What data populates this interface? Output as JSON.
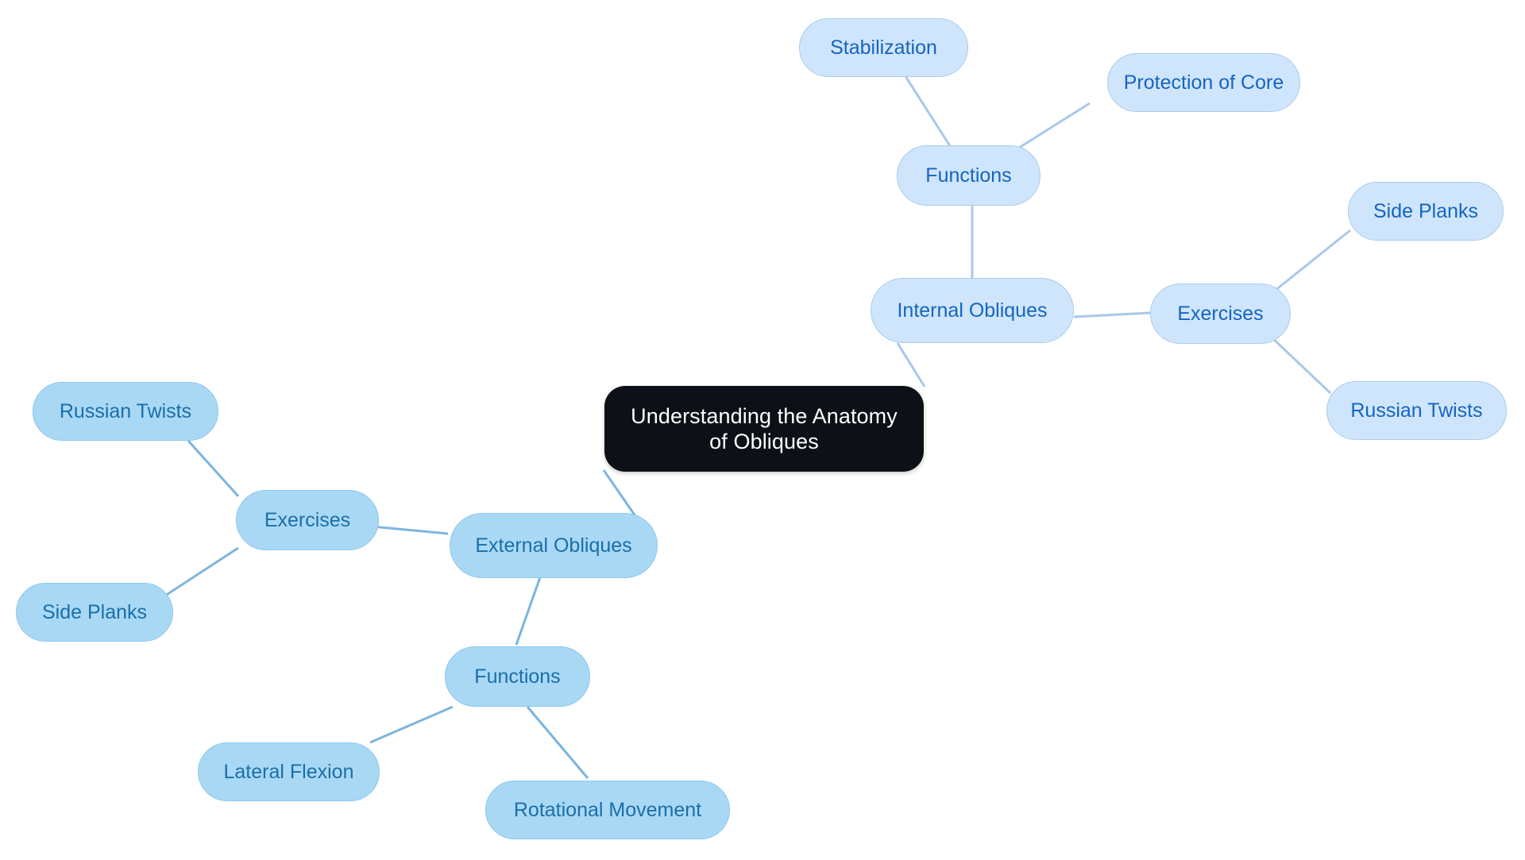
{
  "diagram": {
    "type": "mindmap",
    "title": "Understanding the Anatomy of Obliques",
    "background_color": "#ffffff",
    "palette": {
      "central_fill": "#0d1117",
      "central_text": "#ffffff",
      "right_branch_fill": "#cfe5fb",
      "right_branch_border": "#a9cdee",
      "right_branch_text": "#1565c0",
      "left_branch_fill": "#a9d8f5",
      "left_branch_border": "#8ec7ec",
      "left_branch_text": "#1a6fa8",
      "edge_right": "#a8c8ea",
      "edge_left": "#7cb5dd"
    }
  },
  "nodes": {
    "central": {
      "label": "Understanding the Anatomy of Obliques",
      "level": 0
    },
    "internal_obliques": {
      "label": "Internal Obliques",
      "level": 1,
      "side": "right"
    },
    "internal_functions": {
      "label": "Functions",
      "level": 2,
      "side": "right"
    },
    "internal_functions_leaf_1": {
      "label": "Stabilization",
      "level": 3,
      "side": "right"
    },
    "internal_functions_leaf_2": {
      "label": "Protection of Core",
      "level": 3,
      "side": "right"
    },
    "internal_exercises": {
      "label": "Exercises",
      "level": 2,
      "side": "right"
    },
    "internal_exercises_leaf_1": {
      "label": "Side Planks",
      "level": 3,
      "side": "right"
    },
    "internal_exercises_leaf_2": {
      "label": "Russian Twists",
      "level": 3,
      "side": "right"
    },
    "external_obliques": {
      "label": "External Obliques",
      "level": 1,
      "side": "left"
    },
    "external_exercises": {
      "label": "Exercises",
      "level": 2,
      "side": "left"
    },
    "external_exercises_leaf_1": {
      "label": "Russian Twists",
      "level": 3,
      "side": "left"
    },
    "external_exercises_leaf_2": {
      "label": "Side Planks",
      "level": 3,
      "side": "left"
    },
    "external_functions": {
      "label": "Functions",
      "level": 2,
      "side": "left"
    },
    "external_functions_leaf_1": {
      "label": "Lateral Flexion",
      "level": 3,
      "side": "left"
    },
    "external_functions_leaf_2": {
      "label": "Rotational Movement",
      "level": 3,
      "side": "left"
    }
  },
  "edges": [
    {
      "from": "central",
      "to": "internal_obliques"
    },
    {
      "from": "internal_obliques",
      "to": "internal_functions"
    },
    {
      "from": "internal_functions",
      "to": "internal_functions_leaf_1"
    },
    {
      "from": "internal_functions",
      "to": "internal_functions_leaf_2"
    },
    {
      "from": "internal_obliques",
      "to": "internal_exercises"
    },
    {
      "from": "internal_exercises",
      "to": "internal_exercises_leaf_1"
    },
    {
      "from": "internal_exercises",
      "to": "internal_exercises_leaf_2"
    },
    {
      "from": "central",
      "to": "external_obliques"
    },
    {
      "from": "external_obliques",
      "to": "external_exercises"
    },
    {
      "from": "external_exercises",
      "to": "external_exercises_leaf_1"
    },
    {
      "from": "external_exercises",
      "to": "external_exercises_leaf_2"
    },
    {
      "from": "external_obliques",
      "to": "external_functions"
    },
    {
      "from": "external_functions",
      "to": "external_functions_leaf_1"
    },
    {
      "from": "external_functions",
      "to": "external_functions_leaf_2"
    }
  ]
}
